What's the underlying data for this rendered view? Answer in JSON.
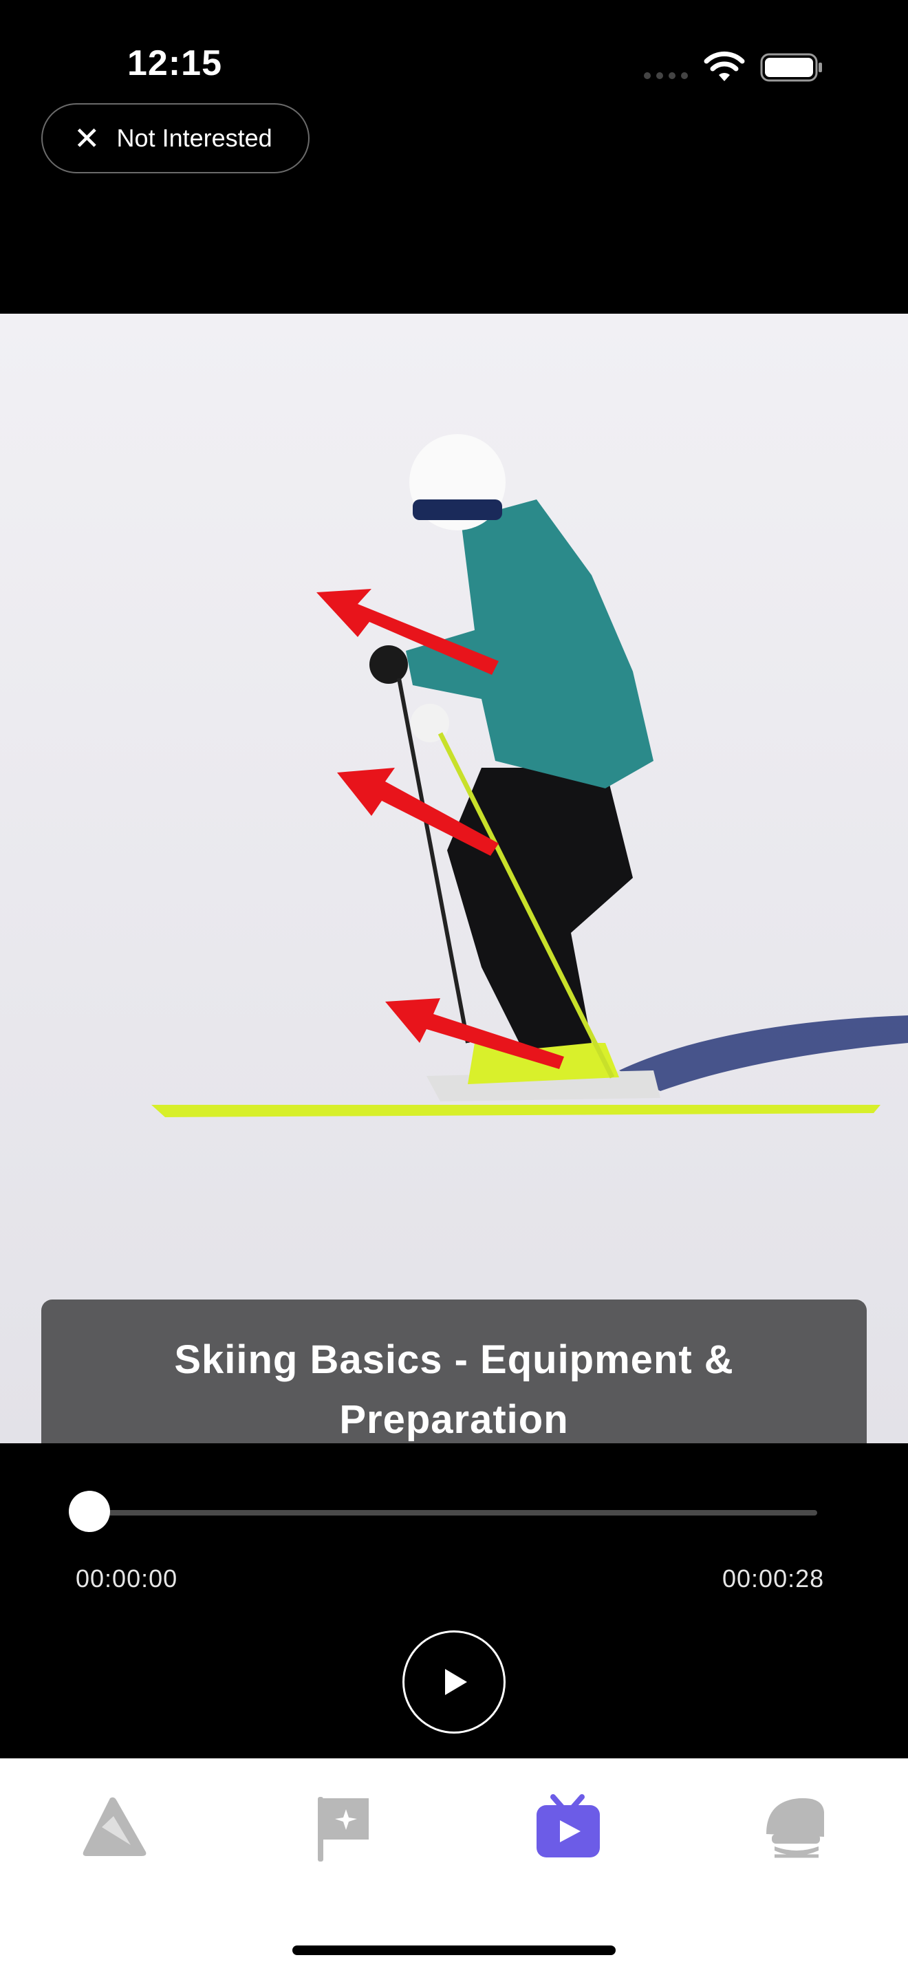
{
  "status_bar": {
    "time": "12:15",
    "icons": [
      "signal-icon",
      "wifi-icon",
      "battery-icon"
    ]
  },
  "header": {
    "not_interested_label": "Not Interested",
    "not_interested_icon": "close-icon"
  },
  "video": {
    "caption": "Skiing Basics - Equipment & Preparation",
    "progress": 0,
    "time_elapsed": "00:00:00",
    "time_total": "00:00:28",
    "play_icon": "play-icon"
  },
  "tab_bar": {
    "tabs": [
      {
        "icon": "mountain-icon",
        "active": false
      },
      {
        "icon": "flag-icon",
        "active": false
      },
      {
        "icon": "video-icon",
        "active": true
      },
      {
        "icon": "helmet-icon",
        "active": false
      }
    ],
    "active_color": "#6c5ce7",
    "inactive_color": "#b8b8b8"
  },
  "colors": {
    "background": "#000000",
    "caption_bg": "#5a5a5c",
    "arrow": "#e8141b"
  }
}
